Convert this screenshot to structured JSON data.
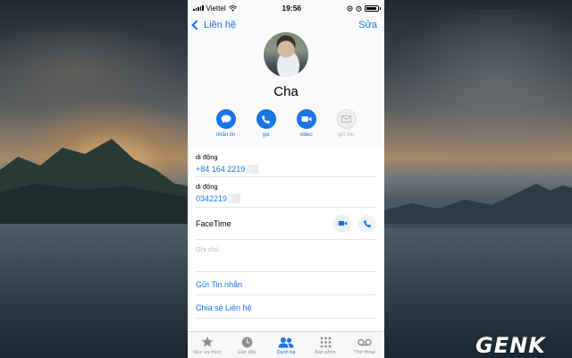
{
  "status_bar": {
    "carrier": "Viettel",
    "time": "19:56"
  },
  "nav": {
    "back_label": "Liên hệ",
    "edit_label": "Sửa"
  },
  "contact": {
    "name": "Cha"
  },
  "actions": [
    {
      "label": "nhắn tin",
      "icon": "message-icon",
      "enabled": true
    },
    {
      "label": "gọi",
      "icon": "phone-icon",
      "enabled": true
    },
    {
      "label": "video",
      "icon": "video-icon",
      "enabled": true
    },
    {
      "label": "gửi thư",
      "icon": "mail-icon",
      "enabled": false
    }
  ],
  "phones": [
    {
      "label": "di động",
      "value": "+84 164 2219"
    },
    {
      "label": "di động",
      "value": "0342219"
    }
  ],
  "facetime": {
    "label": "FaceTime"
  },
  "notes": {
    "placeholder": "Ghi chú"
  },
  "links": {
    "send_message": "Gửi Tin nhắn",
    "share_contact": "Chia sẻ Liên hệ"
  },
  "tabs": [
    {
      "label": "Mục ưa thích",
      "icon": "star-icon",
      "active": false
    },
    {
      "label": "Gần đây",
      "icon": "clock-icon",
      "active": false
    },
    {
      "label": "Danh bạ",
      "icon": "contacts-icon",
      "active": true
    },
    {
      "label": "Bàn phím",
      "icon": "keypad-icon",
      "active": false
    },
    {
      "label": "Thư thoại",
      "icon": "voicemail-icon",
      "active": false
    }
  ],
  "watermark": {
    "text": "GENK"
  },
  "colors": {
    "accent": "#1a73e8",
    "disabled": "#b8b8bc"
  }
}
